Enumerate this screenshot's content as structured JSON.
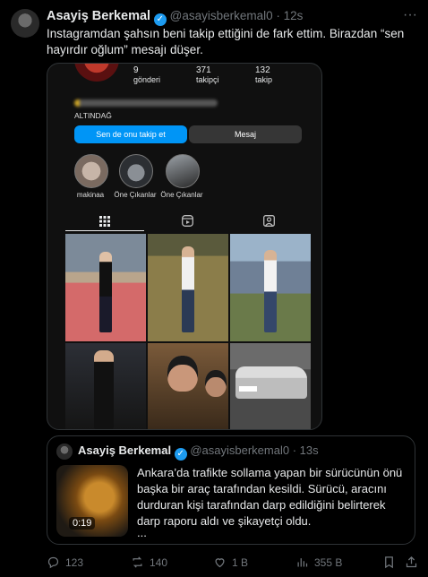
{
  "tweet": {
    "author_name": "Asayiş Berkemal",
    "handle": "@asayisberkemal0",
    "separator": "·",
    "time": "12s",
    "text": "Instagramdan şahsın beni takip ettiğini de fark ettim. Birazdan “sen hayırdır oğlum” mesajı düşer."
  },
  "instagram": {
    "stats": [
      {
        "num": "9",
        "label": "gönderi"
      },
      {
        "num": "371",
        "label": "takipçi"
      },
      {
        "num": "132",
        "label": "takip"
      }
    ],
    "location": "ALTINDAĞ",
    "follow_back_label": "Sen de onu takip et",
    "message_label": "Mesaj",
    "highlights": [
      {
        "label": "makinaa"
      },
      {
        "label": "Öne Çıkanlar"
      },
      {
        "label": "Öne Çıkanlar"
      }
    ]
  },
  "quoted": {
    "author_name": "Asayiş Berkemal",
    "handle": "@asayisberkemal0",
    "separator": "·",
    "time": "13s",
    "video_duration": "0:19",
    "text": "Ankara’da trafikte sollama yapan bir sürücünün önü başka bir araç tarafından kesildi. Sürücü, aracını durduran kişi tarafından darp edildiğini belirterek darp raporu aldı ve şikayetçi oldu.",
    "ellipsis": "..."
  },
  "actions": {
    "replies": "123",
    "reposts": "140",
    "likes": "1 B",
    "views": "355 B"
  },
  "colors": {
    "accent": "#1d9bf0",
    "instagram_follow": "#0095f6"
  }
}
